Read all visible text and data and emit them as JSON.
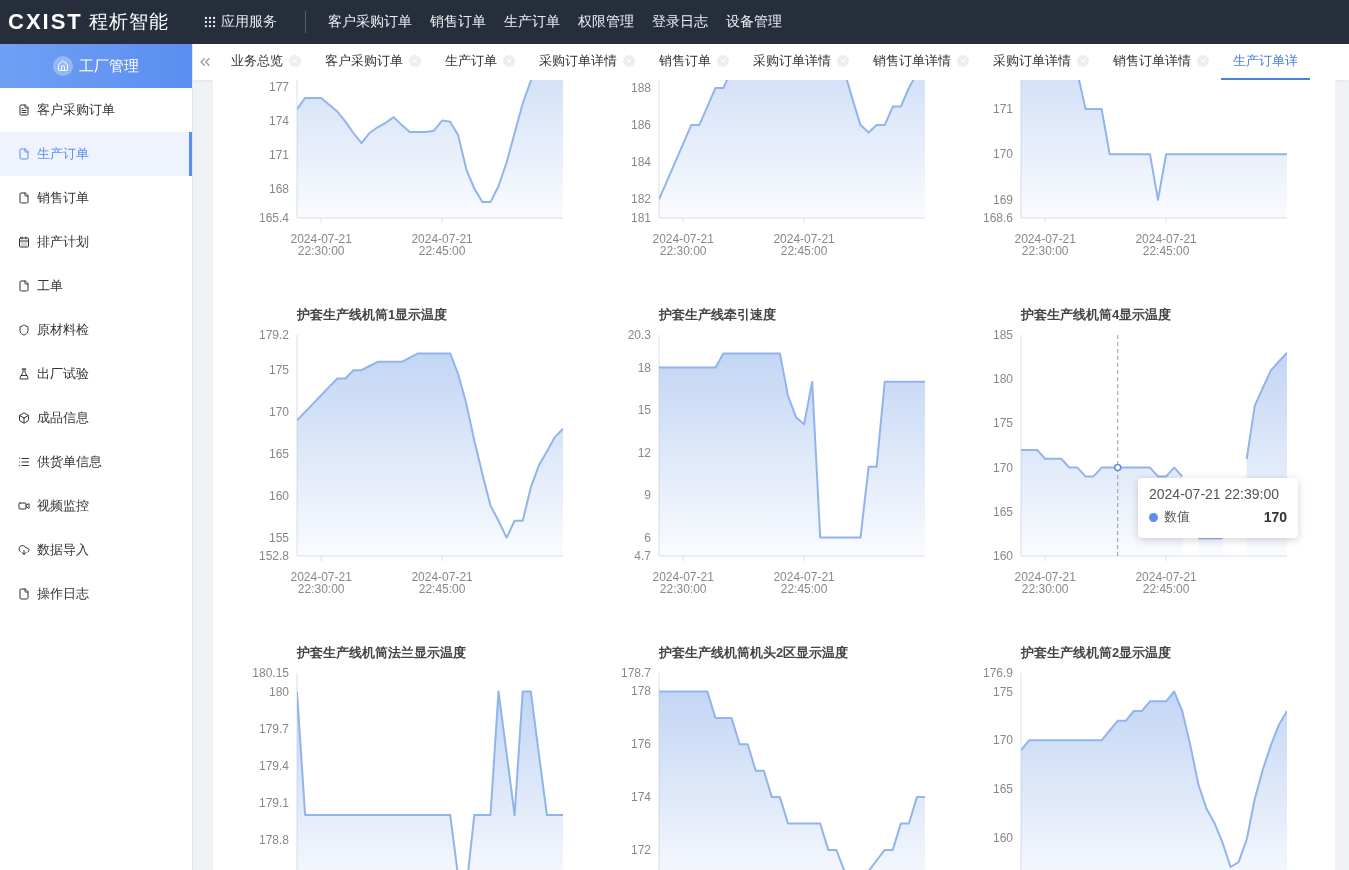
{
  "header": {
    "logo_text": "CXIST",
    "brand": "程析智能",
    "apps_label": "应用服务",
    "nav": [
      "客户采购订单",
      "销售订单",
      "生产订单",
      "权限管理",
      "登录日志",
      "设备管理"
    ]
  },
  "sidebar": {
    "title": "工厂管理",
    "items": [
      {
        "label": "客户采购订单",
        "selected": false
      },
      {
        "label": "生产订单",
        "selected": true
      },
      {
        "label": "销售订单",
        "selected": false
      },
      {
        "label": "排产计划",
        "selected": false
      },
      {
        "label": "工单",
        "selected": false
      },
      {
        "label": "原材料检",
        "selected": false
      },
      {
        "label": "出厂试验",
        "selected": false
      },
      {
        "label": "成品信息",
        "selected": false
      },
      {
        "label": "供货单信息",
        "selected": false
      },
      {
        "label": "视频监控",
        "selected": false
      },
      {
        "label": "数据导入",
        "selected": false
      },
      {
        "label": "操作日志",
        "selected": false
      }
    ]
  },
  "tabs": [
    {
      "label": "业务总览",
      "selected": false
    },
    {
      "label": "客户采购订单",
      "selected": false
    },
    {
      "label": "生产订单",
      "selected": false
    },
    {
      "label": "采购订单详情",
      "selected": false
    },
    {
      "label": "销售订单",
      "selected": false
    },
    {
      "label": "采购订单详情",
      "selected": false
    },
    {
      "label": "销售订单详情",
      "selected": false
    },
    {
      "label": "采购订单详情",
      "selected": false
    },
    {
      "label": "销售订单详情",
      "selected": false
    },
    {
      "label": "生产订单详",
      "selected": true
    }
  ],
  "charts": [
    {
      "chart_data": {
        "type": "area",
        "categories": [
          null,
          null,
          null,
          "2024-07-21 22:30:00",
          null,
          null,
          null,
          null,
          null,
          null,
          null,
          null,
          null,
          null,
          null,
          null,
          null,
          null,
          "2024-07-21 22:45:00",
          null,
          null,
          null,
          null,
          null,
          null,
          null,
          null,
          null,
          null,
          null,
          null,
          null,
          null,
          null
        ],
        "series": [
          {
            "color": "#92b4ec",
            "values": [
              175,
              176,
              176,
              176,
              175.4,
              174.8,
              173.9,
              172.9,
              172,
              172.9,
              173.4,
              173.8,
              174.3,
              173.6,
              173,
              173,
              173,
              173.1,
              174,
              173.9,
              172.7,
              169.7,
              168,
              166.8,
              166.8,
              168.2,
              170.3,
              172.9,
              175.5,
              177.5,
              179,
              180.4,
              181.8,
              183
            ]
          }
        ],
        "ylim": [
          165.4,
          184.9
        ],
        "yticks": [
          165.4,
          168,
          171,
          174,
          177
        ]
      }
    },
    {
      "chart_data": {
        "type": "area",
        "categories": [
          null,
          null,
          null,
          "2024-07-21 22:30:00",
          null,
          null,
          null,
          null,
          null,
          null,
          null,
          null,
          null,
          null,
          null,
          null,
          null,
          null,
          "2024-07-21 22:45:00",
          null,
          null,
          null,
          null,
          null,
          null,
          null,
          null,
          null,
          null,
          null,
          null,
          null,
          null,
          null
        ],
        "series": [
          {
            "color": "#92b4ec",
            "values": [
              182,
              183,
              184,
              185,
              186,
              186,
              187,
              188,
              188,
              189,
              190,
              190,
              190,
              190,
              190,
              190,
              190,
              190,
              190,
              190,
              190,
              190,
              189.5,
              188.9,
              187.4,
              186,
              185.6,
              186,
              186,
              187,
              187,
              188,
              188.8,
              189.5
            ]
          }
        ],
        "ylim": [
          181,
          192.9
        ],
        "yticks": [
          181,
          182,
          184,
          186,
          188
        ]
      }
    },
    {
      "chart_data": {
        "type": "area",
        "categories": [
          null,
          null,
          null,
          "2024-07-21 22:30:00",
          null,
          null,
          null,
          null,
          null,
          null,
          null,
          null,
          null,
          null,
          null,
          null,
          null,
          null,
          "2024-07-21 22:45:00",
          null,
          null,
          null,
          null,
          null,
          null,
          null,
          null,
          null,
          null,
          null,
          null,
          null,
          null,
          null
        ],
        "series": [
          {
            "color": "#92b4ec",
            "values": [
              172.5,
              172.5,
              172.5,
              172.5,
              172.5,
              172.5,
              172.5,
              171.8,
              171,
              171,
              171,
              170,
              170,
              170,
              170,
              170,
              170,
              169,
              170,
              170,
              170,
              170,
              170,
              170,
              170,
              170,
              170,
              170,
              170,
              170,
              170,
              170,
              170,
              170
            ]
          }
        ],
        "ylim": [
          168.6,
          173.46
        ],
        "yticks": [
          168.6,
          169,
          170,
          171
        ]
      }
    },
    {
      "chart_data": {
        "type": "area",
        "title": "护套生产线机筒1显示温度",
        "categories": [
          null,
          null,
          null,
          "2024-07-21 22:30:00",
          null,
          null,
          null,
          null,
          null,
          null,
          null,
          null,
          null,
          null,
          null,
          null,
          null,
          null,
          "2024-07-21 22:45:00",
          null,
          null,
          null,
          null,
          null,
          null,
          null,
          null,
          null,
          null,
          null,
          null,
          null,
          null,
          null
        ],
        "series": [
          {
            "color": "#92b4ec",
            "values": [
              169,
              170,
              171,
              172,
              173,
              174,
              174,
              175,
              175,
              175.5,
              176,
              176,
              176,
              176,
              176.5,
              177,
              177,
              177,
              177,
              177,
              174.5,
              171,
              166.6,
              162.6,
              158.8,
              157,
              155,
              157,
              157,
              161,
              163.6,
              165.3,
              167,
              168
            ]
          }
        ],
        "ylim": [
          152.8,
          179.2
        ],
        "yticks": [
          152.8,
          155,
          160,
          165,
          170,
          175,
          179.2
        ]
      }
    },
    {
      "chart_data": {
        "type": "area",
        "title": "护套生产线牵引速度",
        "categories": [
          null,
          null,
          null,
          "2024-07-21 22:30:00",
          null,
          null,
          null,
          null,
          null,
          null,
          null,
          null,
          null,
          null,
          null,
          null,
          null,
          null,
          "2024-07-21 22:45:00",
          null,
          null,
          null,
          null,
          null,
          null,
          null,
          null,
          null,
          null,
          null,
          null,
          null,
          null,
          null
        ],
        "series": [
          {
            "color": "#92b4ec",
            "values": [
              18,
              18,
              18,
              18,
              18,
              18,
              18,
              18,
              19,
              19,
              19,
              19,
              19,
              19,
              19,
              19,
              16,
              14.5,
              14,
              17,
              6,
              6,
              6,
              6,
              6,
              6,
              11,
              11,
              17,
              17,
              17,
              17,
              17,
              17
            ]
          }
        ],
        "ylim": [
          4.7,
          20.3
        ],
        "yticks": [
          4.7,
          6,
          9,
          12,
          15,
          18,
          20.3
        ]
      }
    },
    {
      "chart_data": {
        "type": "area",
        "title": "护套生产线机筒4显示温度",
        "categories": [
          null,
          null,
          null,
          "2024-07-21 22:30:00",
          null,
          null,
          null,
          null,
          null,
          null,
          null,
          null,
          null,
          null,
          null,
          null,
          null,
          null,
          "2024-07-21 22:45:00",
          null,
          null,
          null,
          null,
          null,
          null,
          null,
          null,
          null,
          null,
          null,
          null,
          null,
          null,
          null
        ],
        "series": [
          {
            "name": "数值",
            "color": "#92b4ec",
            "values": [
              172,
              172,
              172,
              171,
              171,
              171,
              170,
              170,
              169,
              169,
              170,
              170,
              170,
              170,
              170,
              170,
              170,
              169,
              169,
              170,
              169,
              null,
              162,
              162,
              162,
              162,
              null,
              null,
              171,
              177,
              179,
              181,
              182,
              183
            ]
          }
        ],
        "ylim": [
          160,
          185
        ],
        "yticks": [
          160,
          165,
          170,
          175,
          180,
          185
        ]
      },
      "tooltip": {
        "title": "2024-07-21 22:39:00",
        "value": "170"
      }
    },
    {
      "chart_data": {
        "type": "area",
        "title": "护套生产线机筒法兰显示温度",
        "categories": [
          null,
          null,
          null,
          null,
          null,
          null,
          null,
          null,
          null,
          null,
          null,
          null,
          null,
          null,
          null,
          null,
          null,
          null,
          null,
          null,
          null,
          null,
          null,
          null,
          null,
          null,
          null,
          null,
          null,
          null,
          null,
          null,
          null,
          null
        ],
        "series": [
          {
            "color": "#92b4ec",
            "values": [
              180,
              179,
              179,
              179,
              179,
              179,
              179,
              179,
              179,
              179,
              179,
              179,
              179,
              179,
              179,
              179,
              179,
              179,
              179,
              179,
              178.5,
              178.4,
              179,
              179,
              179,
              180,
              179.5,
              179,
              180,
              180,
              179.5,
              179,
              179,
              179
            ]
          }
        ],
        "ylim": [
          178.36,
          180.15
        ],
        "yticks": [
          178.8,
          179.1,
          179.4,
          179.7,
          180,
          180.15
        ]
      }
    },
    {
      "chart_data": {
        "type": "area",
        "title": "护套生产线机筒机头2区显示温度",
        "categories": [
          null,
          null,
          null,
          null,
          null,
          null,
          null,
          null,
          null,
          null,
          null,
          null,
          null,
          null,
          null,
          null,
          null,
          null,
          null,
          null,
          null,
          null,
          null,
          null,
          null,
          null,
          null,
          null,
          null,
          null,
          null,
          null,
          null,
          null
        ],
        "series": [
          {
            "color": "#92b4ec",
            "values": [
              178,
              178,
              178,
              178,
              178,
              178,
              178,
              177,
              177,
              177,
              176,
              176,
              175,
              175,
              174,
              174,
              173,
              173,
              173,
              173,
              173,
              172,
              172,
              171.2,
              170.8,
              170.8,
              171.2,
              171.6,
              172,
              172,
              173,
              173,
              174,
              174
            ]
          }
        ],
        "ylim": [
          170.33,
          178.7
        ],
        "yticks": [
          172,
          174,
          176,
          178,
          178.7
        ]
      }
    },
    {
      "chart_data": {
        "type": "area",
        "title": "护套生产线机筒2显示温度",
        "categories": [
          null,
          null,
          null,
          null,
          null,
          null,
          null,
          null,
          null,
          null,
          null,
          null,
          null,
          null,
          null,
          null,
          null,
          null,
          null,
          null,
          null,
          null,
          null,
          null,
          null,
          null,
          null,
          null,
          null,
          null,
          null,
          null,
          null,
          null
        ],
        "series": [
          {
            "color": "#92b4ec",
            "values": [
              169,
              170,
              170,
              170,
              170,
              170,
              170,
              170,
              170,
              170,
              170,
              171,
              172,
              172,
              173,
              173,
              174,
              174,
              174,
              175,
              173,
              169.5,
              165.5,
              163,
              161.5,
              159.5,
              157,
              157.5,
              159.8,
              164,
              167,
              169.5,
              171.6,
              173
            ]
          }
        ],
        "ylim": [
          154.23,
          176.9
        ],
        "yticks": [
          160,
          165,
          170,
          175,
          176.9
        ]
      }
    }
  ]
}
